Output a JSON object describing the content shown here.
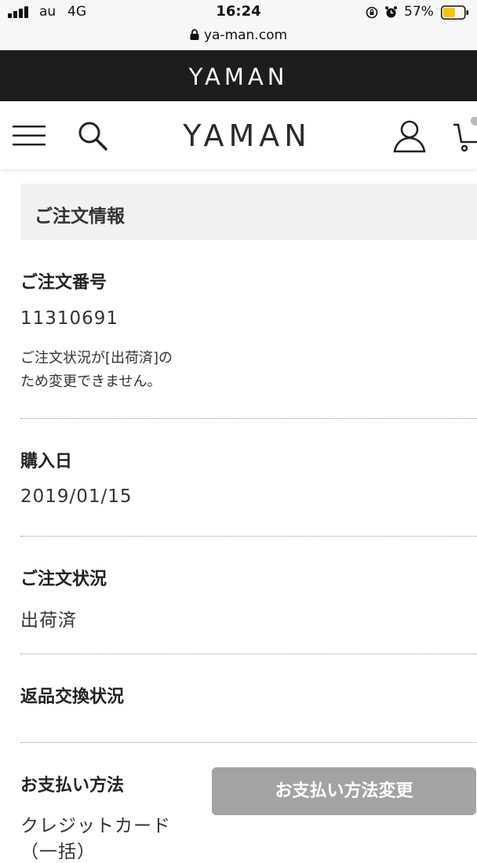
{
  "status_bar": {
    "carrier": "au",
    "network": "4G",
    "time": "16:24",
    "battery_percent": "57%",
    "battery_level": 0.57,
    "icons": [
      "signal-icon",
      "orientation-lock-icon",
      "alarm-icon",
      "battery-icon"
    ]
  },
  "browser": {
    "url": "ya-man.com",
    "icons": [
      "padlock-icon"
    ]
  },
  "brand_band": {
    "logo": "YAMAN"
  },
  "header": {
    "logo": "YAMAN",
    "icons": [
      "menu-icon",
      "search-icon",
      "account-icon",
      "cart-icon"
    ]
  },
  "order": {
    "section_title": "ご注文情報",
    "order_number_label": "ご注文番号",
    "order_number": "11310691",
    "note_line1": "ご注文状況が[出荷済]の",
    "note_line2": "ため変更できません。",
    "purchase_date_label": "購入日",
    "purchase_date": "2019/01/15",
    "status_label": "ご注文状況",
    "status": "出荷済",
    "return_label": "返品交換状況",
    "payment_label": "お支払い方法",
    "payment_method": "クレジットカード",
    "payment_method_cont": "（一括）",
    "change_payment_button": "お支払い方法変更"
  },
  "colors": {
    "band": "#1d1d1d",
    "heading_bg": "#f1f1f1",
    "button_bg": "#a3a3a3"
  }
}
